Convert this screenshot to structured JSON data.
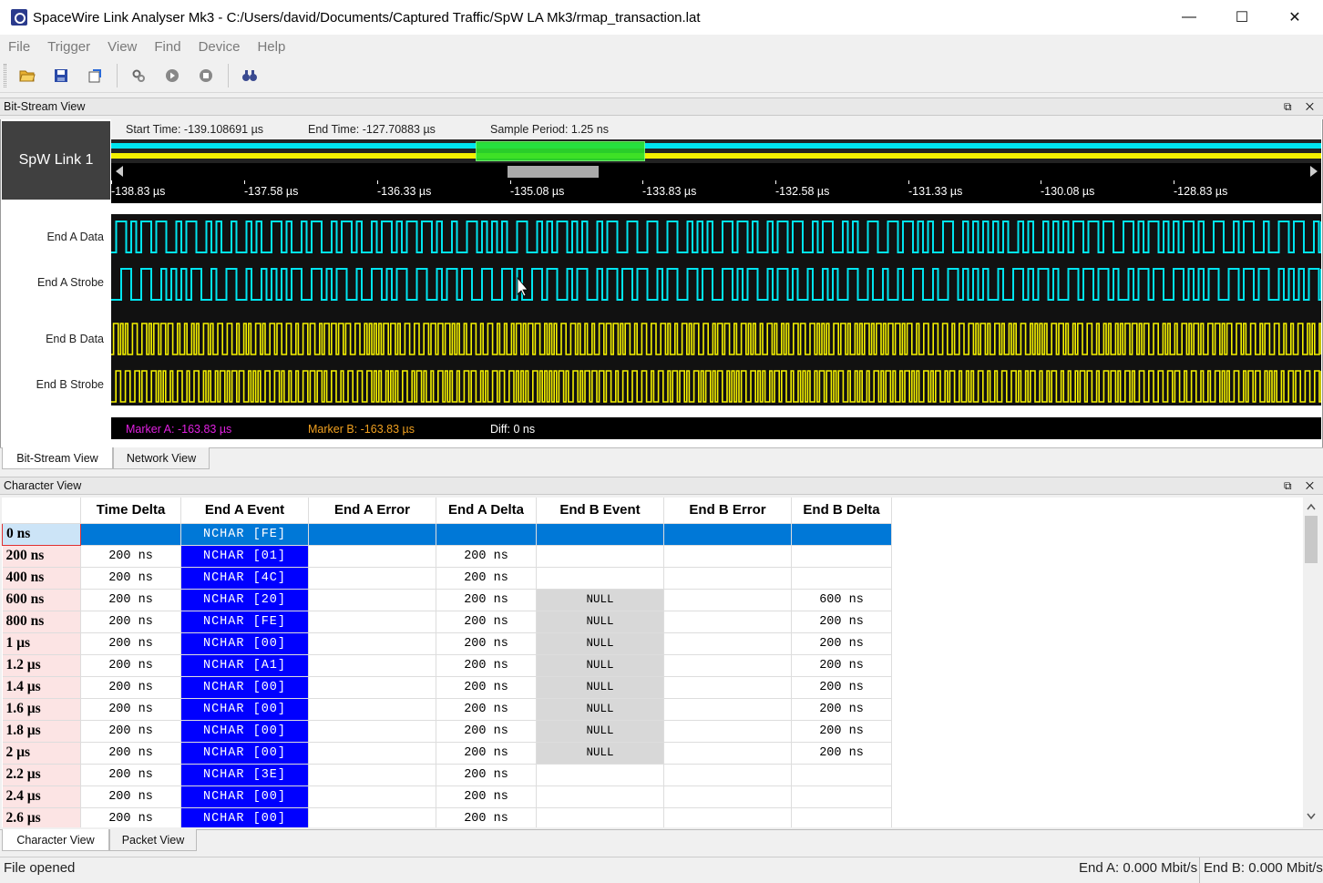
{
  "window": {
    "title": "SpaceWire Link Analyser Mk3 - C:/Users/david/Documents/Captured Traffic/SpW LA Mk3/rmap_transaction.lat",
    "minimize": "—",
    "maximize": "☐",
    "close": "✕"
  },
  "menu": [
    "File",
    "Trigger",
    "View",
    "Find",
    "Device",
    "Help"
  ],
  "toolbar": {
    "icons": [
      "open-folder-icon",
      "save-icon",
      "export-icon",
      "settings-icon",
      "play-icon",
      "stop-icon",
      "find-icon"
    ]
  },
  "bitstream": {
    "panel_title": "Bit-Stream View",
    "panel_controls": "⧉ ✕",
    "link_label": "SpW Link 1",
    "start_time": "Start Time: -139.108691 µs",
    "end_time": "End Time: -127.70883 µs",
    "sample_period": "Sample Period: 1.25 ns",
    "ticks": [
      "-138.83 µs",
      "-137.58 µs",
      "-136.33 µs",
      "-135.08 µs",
      "-133.83 µs",
      "-132.58 µs",
      "-131.33 µs",
      "-130.08 µs",
      "-128.83 µs"
    ],
    "signals": [
      "End A Data",
      "End A Strobe",
      "End B Data",
      "End B Strobe"
    ],
    "marker_a": "Marker A: -163.83 µs",
    "marker_b": "Marker B: -163.83 µs",
    "diff": "Diff: 0 ns",
    "colors": {
      "end_a": "#00e5f0",
      "end_b": "#f4f000",
      "marker_a": "#e020e0",
      "marker_b": "#f0a020"
    }
  },
  "top_tabs": [
    "Bit-Stream View",
    "Network View"
  ],
  "character": {
    "panel_title": "Character View",
    "panel_controls": "⧉ ✕",
    "columns": [
      "",
      "Time Delta",
      "End A Event",
      "End A Error",
      "End A Delta",
      "End B Event",
      "End B Error",
      "End B Delta"
    ],
    "rows": [
      {
        "time": "0 ns",
        "delta": "",
        "a_event": "NCHAR [FE]",
        "a_error": "",
        "a_delta": "",
        "b_event": "",
        "b_error": "",
        "b_delta": ""
      },
      {
        "time": "200 ns",
        "delta": "200 ns",
        "a_event": "NCHAR [01]",
        "a_error": "",
        "a_delta": "200 ns",
        "b_event": "",
        "b_error": "",
        "b_delta": ""
      },
      {
        "time": "400 ns",
        "delta": "200 ns",
        "a_event": "NCHAR [4C]",
        "a_error": "",
        "a_delta": "200 ns",
        "b_event": "",
        "b_error": "",
        "b_delta": ""
      },
      {
        "time": "600 ns",
        "delta": "200 ns",
        "a_event": "NCHAR [20]",
        "a_error": "",
        "a_delta": "200 ns",
        "b_event": "NULL",
        "b_error": "",
        "b_delta": "600 ns"
      },
      {
        "time": "800 ns",
        "delta": "200 ns",
        "a_event": "NCHAR [FE]",
        "a_error": "",
        "a_delta": "200 ns",
        "b_event": "NULL",
        "b_error": "",
        "b_delta": "200 ns"
      },
      {
        "time": "1 µs",
        "delta": "200 ns",
        "a_event": "NCHAR [00]",
        "a_error": "",
        "a_delta": "200 ns",
        "b_event": "NULL",
        "b_error": "",
        "b_delta": "200 ns"
      },
      {
        "time": "1.2 µs",
        "delta": "200 ns",
        "a_event": "NCHAR [A1]",
        "a_error": "",
        "a_delta": "200 ns",
        "b_event": "NULL",
        "b_error": "",
        "b_delta": "200 ns"
      },
      {
        "time": "1.4 µs",
        "delta": "200 ns",
        "a_event": "NCHAR [00]",
        "a_error": "",
        "a_delta": "200 ns",
        "b_event": "NULL",
        "b_error": "",
        "b_delta": "200 ns"
      },
      {
        "time": "1.6 µs",
        "delta": "200 ns",
        "a_event": "NCHAR [00]",
        "a_error": "",
        "a_delta": "200 ns",
        "b_event": "NULL",
        "b_error": "",
        "b_delta": "200 ns"
      },
      {
        "time": "1.8 µs",
        "delta": "200 ns",
        "a_event": "NCHAR [00]",
        "a_error": "",
        "a_delta": "200 ns",
        "b_event": "NULL",
        "b_error": "",
        "b_delta": "200 ns"
      },
      {
        "time": "2 µs",
        "delta": "200 ns",
        "a_event": "NCHAR [00]",
        "a_error": "",
        "a_delta": "200 ns",
        "b_event": "NULL",
        "b_error": "",
        "b_delta": "200 ns"
      },
      {
        "time": "2.2 µs",
        "delta": "200 ns",
        "a_event": "NCHAR [3E]",
        "a_error": "",
        "a_delta": "200 ns",
        "b_event": "",
        "b_error": "",
        "b_delta": ""
      },
      {
        "time": "2.4 µs",
        "delta": "200 ns",
        "a_event": "NCHAR [00]",
        "a_error": "",
        "a_delta": "200 ns",
        "b_event": "",
        "b_error": "",
        "b_delta": ""
      },
      {
        "time": "2.6 µs",
        "delta": "200 ns",
        "a_event": "NCHAR [00]",
        "a_error": "",
        "a_delta": "200 ns",
        "b_event": "",
        "b_error": "",
        "b_delta": ""
      }
    ]
  },
  "bottom_tabs": [
    "Character View",
    "Packet View"
  ],
  "status": {
    "left": "File opened",
    "end_a": "End A: 0.000 Mbit/s",
    "end_b": "End B: 0.000 Mbit/s"
  }
}
